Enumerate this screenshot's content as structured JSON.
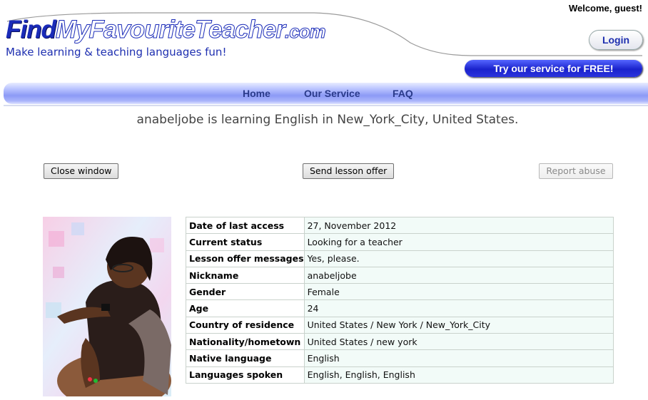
{
  "header": {
    "logo_find": "Find",
    "logo_rest": "MyFavouriteTeacher",
    "logo_com": ".com",
    "tagline": "Make learning & teaching languages fun!",
    "welcome": "Welcome, guest!",
    "login_label": "Login",
    "try_label": "Try our service for FREE!"
  },
  "nav": {
    "home": "Home",
    "service": "Our Service",
    "faq": "FAQ"
  },
  "headline": "anabeljobe is learning English in New_York_City, United States.",
  "actions": {
    "close": "Close window",
    "send": "Send lesson offer",
    "report": "Report abuse"
  },
  "profile": [
    {
      "label": "Date of last access",
      "value": "27, November 2012"
    },
    {
      "label": "Current status",
      "value": "Looking for a teacher"
    },
    {
      "label": "Lesson offer messages",
      "value": "Yes, please."
    },
    {
      "label": "Nickname",
      "value": "anabeljobe"
    },
    {
      "label": "Gender",
      "value": "Female"
    },
    {
      "label": "Age",
      "value": "24"
    },
    {
      "label": "Country of residence",
      "value": "United States / New York / New_York_City"
    },
    {
      "label": "Nationality/hometown",
      "value": "United States / new york"
    },
    {
      "label": "Native language",
      "value": "English"
    },
    {
      "label": "Languages spoken",
      "value": "English, English, English"
    }
  ],
  "colors": {
    "brand_blue": "#1a2bb8",
    "nav_gradient": "#8c9af6",
    "value_cell_bg": "#f2fbf8"
  },
  "icons": {
    "photo": "user-profile-photo"
  }
}
